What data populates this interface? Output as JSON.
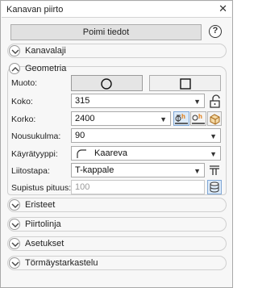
{
  "window": {
    "title": "Kanavan piirto",
    "close_glyph": "✕"
  },
  "toolbar": {
    "fetch_label": "Poimi tiedot",
    "help_glyph": "?"
  },
  "sections": {
    "kanavalaji": "Kanavalaji",
    "geometria": "Geometria",
    "eristeet": "Eristeet",
    "piirtolinja": "Piirtolinja",
    "asetukset": "Asetukset",
    "tormays": "Törmäystarkastelu"
  },
  "geometry": {
    "shape_label": "Muoto:",
    "size_label": "Koko:",
    "size_value": "315",
    "height_label": "Korko:",
    "height_value": "2400",
    "rise_label": "Nousukulma:",
    "rise_value": "90",
    "bend_label": "Käyrätyyppi:",
    "bend_value": "Kaareva",
    "joint_label": "Liitostapa:",
    "joint_value": "T-kappale",
    "reduce_label": "Supistus pituus:",
    "reduce_value": "100"
  },
  "icons": {
    "close": "close-icon",
    "help": "help-icon",
    "circle": "circle-shape-icon",
    "square": "square-shape-icon",
    "lock": "lock-icon",
    "height_top": "height-top-icon",
    "height_bottom": "height-bottom-icon",
    "duct3d": "duct-3d-icon",
    "bend": "bend-icon",
    "tee": "tee-connection-icon",
    "cylinder": "cylinder-icon"
  },
  "colors": {
    "accent_orange": "#e07a10",
    "selected_bg": "#e5e5e5",
    "active_blue": "#dceaf8"
  }
}
